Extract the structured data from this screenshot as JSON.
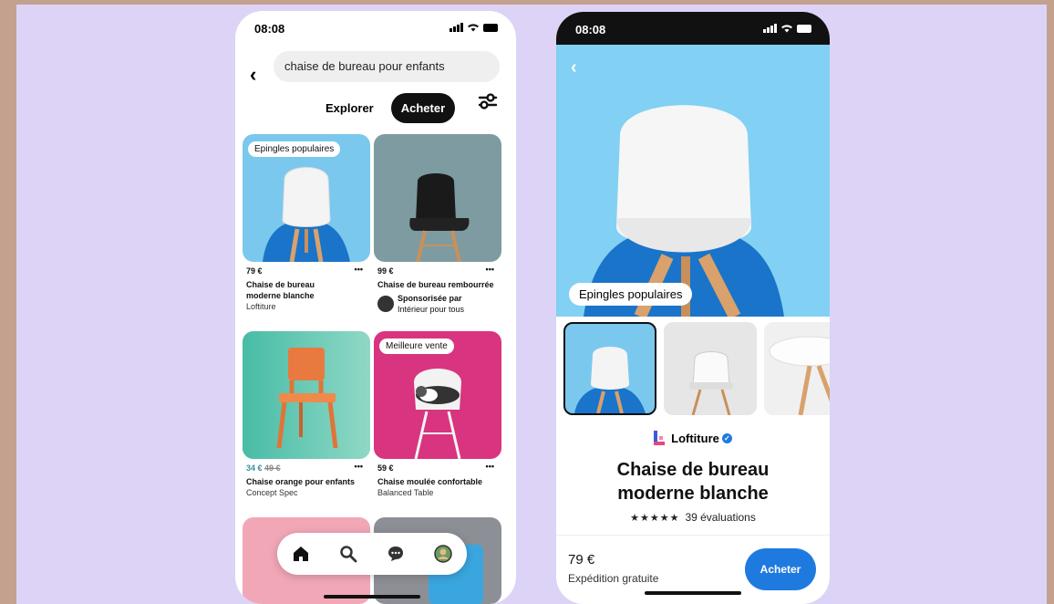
{
  "left": {
    "time": "08:08",
    "search_value": "chaise de bureau pour enfants",
    "tabs": [
      {
        "label": "Explorer"
      },
      {
        "label": "Acheter"
      }
    ],
    "pins": [
      {
        "badge": "Epingles populaires",
        "price": "79 €",
        "title_line1": "Chaise de bureau",
        "title_line2": "moderne blanche",
        "source": "Loftiture"
      },
      {
        "price": "99 €",
        "title": "Chaise de bureau rembourrée",
        "sponsored": "Sponsorisée par",
        "sponsor": "Intérieur pour tous"
      },
      {
        "price_new": "34 €",
        "price_old": "49 €",
        "title": "Chaise orange pour enfants",
        "source": "Concept Spec"
      },
      {
        "badge": "Meilleure vente",
        "price": "59 €",
        "title": "Chaise moulée confortable",
        "source": "Balanced Table"
      }
    ],
    "more": "•••",
    "nav_icons": [
      "home-icon",
      "search-icon",
      "chat-icon",
      "profile-icon"
    ]
  },
  "right": {
    "time": "08:08",
    "badge": "Epingles populaires",
    "brand": "Loftiture",
    "title_line1": "Chaise de bureau",
    "title_line2": "moderne blanche",
    "stars": "★★★★★",
    "rating": "39 évaluations",
    "price": "79 €",
    "shipping": "Expédition gratuite",
    "buy": "Acheter"
  },
  "colors": {
    "accent": "#1f7ae0",
    "background": "#dcd3f7"
  }
}
